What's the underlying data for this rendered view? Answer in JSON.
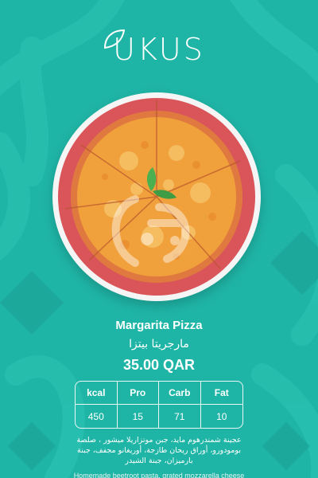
{
  "brand": {
    "name": "UKUS",
    "logo_icon": "leaf-icon"
  },
  "product": {
    "name_en": "Margarita Pizza",
    "name_ar": "مارجريتا بيتزا",
    "price": "35.00 QAR",
    "image": "pizza-on-plate",
    "watermark": "watermark-logo"
  },
  "nutrition": {
    "headers": [
      "kcal",
      "Pro",
      "Carb",
      "Fat"
    ],
    "values": [
      "450",
      "15",
      "71",
      "10"
    ]
  },
  "description_ar": "عجينة شمندرهوم مايد، جبن موتزاريلا ميشور ، صلصة بومودورو، أوراق ريحان طازجة، أوريغانو مجفف، جبنة بارميزان، جبنة الشيدر",
  "description_en": "Homemade beetroot pasta, grated mozzarella cheese",
  "colors": {
    "background": "#1fb5a6",
    "crust": "#d9555a",
    "cheese": "#f0a13b",
    "basil": "#4caf50"
  }
}
